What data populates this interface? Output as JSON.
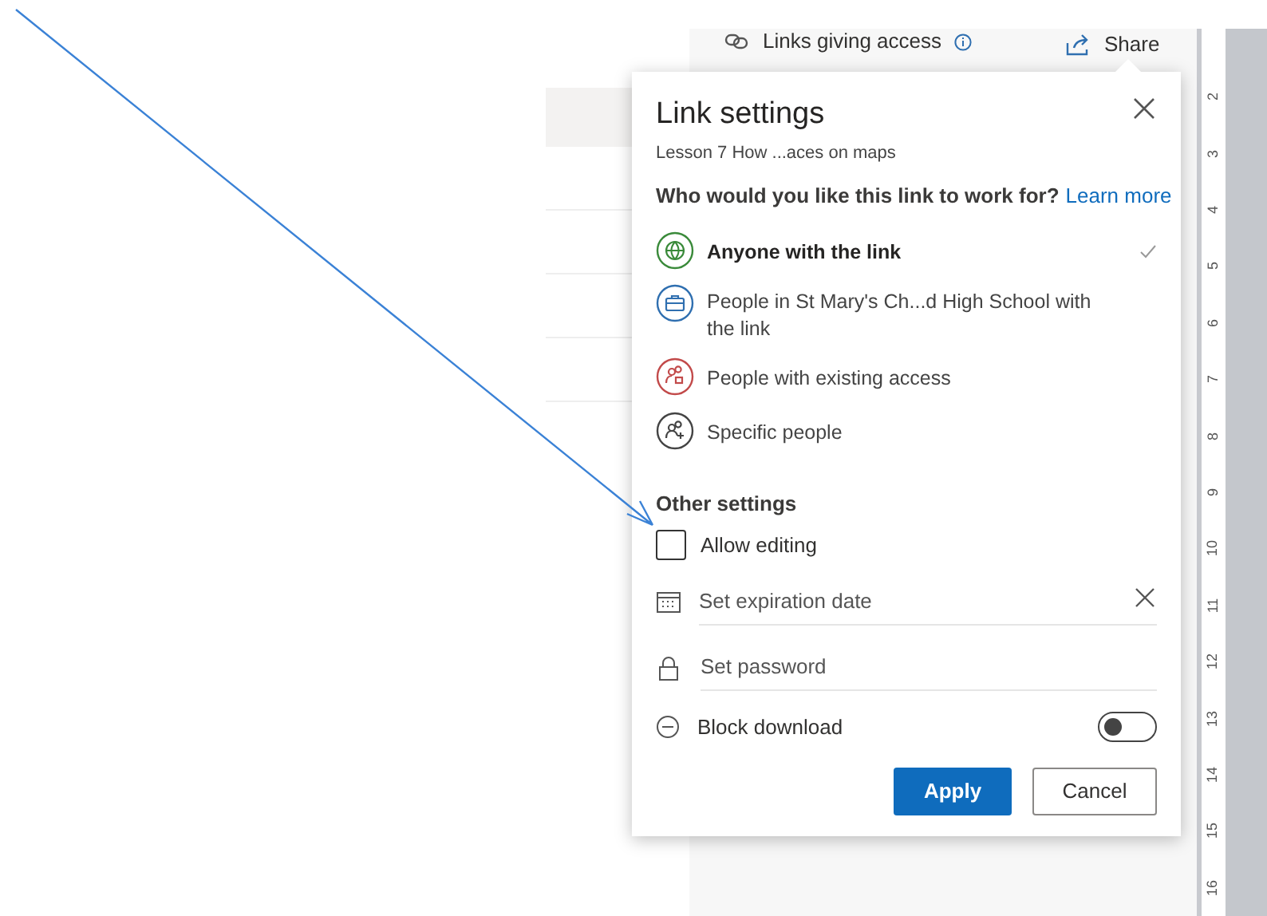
{
  "panel": {
    "links_label": "Links giving access",
    "share_label": "Share"
  },
  "dialog": {
    "title": "Link settings",
    "file_name": "Lesson 7 How ...aces on maps",
    "question": "Who would you like this link to work for?",
    "learn_more": "Learn more",
    "options": [
      {
        "kind": "globe",
        "label": "Anyone with the link",
        "selected": true,
        "color": "#3a8a3a"
      },
      {
        "kind": "briefcase",
        "label": "People in St Mary's Ch...d High School with the link",
        "selected": false,
        "color": "#2f6fb0"
      },
      {
        "kind": "lock-people",
        "label": "People with existing access",
        "selected": false,
        "color": "#c24a4a"
      },
      {
        "kind": "add-people",
        "label": "Specific people",
        "selected": false,
        "color": "#444444"
      }
    ],
    "other_heading": "Other settings",
    "allow_editing": {
      "label": "Allow editing",
      "checked": false
    },
    "expiration": {
      "placeholder": "Set expiration date"
    },
    "password": {
      "placeholder": "Set password"
    },
    "block_download": {
      "label": "Block download",
      "on": false
    },
    "buttons": [
      "Apply",
      "Cancel"
    ]
  },
  "ruler": [
    "2",
    "3",
    "4",
    "5",
    "6",
    "7",
    "8",
    "9",
    "10",
    "11",
    "12",
    "13",
    "14",
    "15",
    "16"
  ]
}
